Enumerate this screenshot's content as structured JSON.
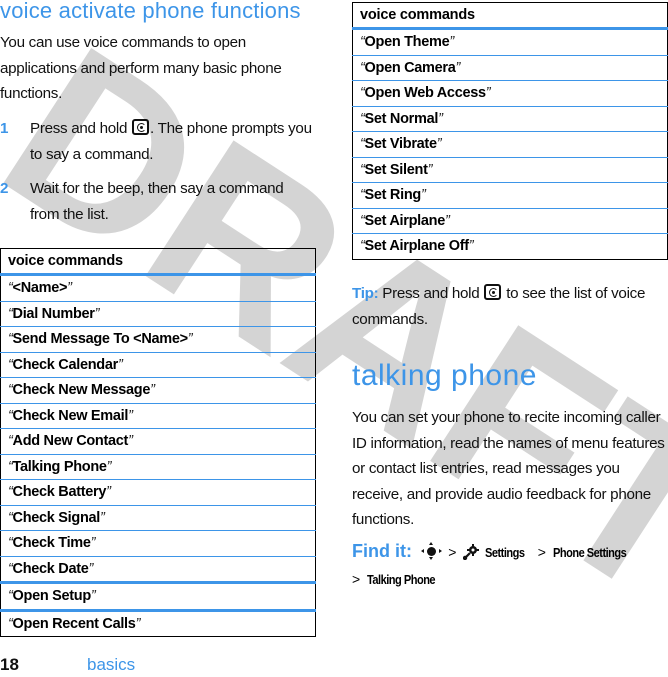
{
  "watermark": "DRAFT",
  "colors": {
    "accent": "#3d95e8",
    "text": "#111111",
    "watermark": "#d4d4d4"
  },
  "left": {
    "heading": "voice activate phone functions",
    "intro": "You can use voice commands to open applications and perform many basic phone functions.",
    "steps": [
      {
        "num": "1",
        "before_icon": "Press and hold ",
        "icon": "voice-key-icon",
        "after_icon": ". The phone prompts you to say a command."
      },
      {
        "num": "2",
        "text": "Wait for the beep, then say a command from the list."
      }
    ],
    "table": {
      "header": "voice commands",
      "rows": [
        "<Name>",
        "Dial Number",
        "Send Message To <Name>",
        "Check Calendar",
        "Check New Message",
        "Check New Email",
        "Add New Contact",
        "Talking Phone",
        "Check Battery",
        "Check Signal",
        "Check Time",
        "Check Date",
        "Open Setup",
        "Open Recent Calls"
      ]
    }
  },
  "right": {
    "table": {
      "header": "voice commands",
      "rows": [
        "Open Theme",
        "Open Camera",
        "Open Web Access",
        "Set Normal",
        "Set Vibrate",
        "Set Silent",
        "Set Ring",
        "Set Airplane",
        "Set Airplane Off"
      ]
    },
    "tip": {
      "label": "Tip:",
      "before_icon": " Press and hold ",
      "icon": "voice-key-icon",
      "after_icon": " to see the list of voice commands."
    },
    "heading": "talking phone",
    "body": "You can set your phone to recite incoming caller ID information, read the names of menu features or contact list entries, read messages you receive, and provide audio feedback for phone functions.",
    "find_it": {
      "label": "Find it:",
      "icons": [
        "nav-key-icon",
        "settings-icon"
      ],
      "separator": ">",
      "path": [
        "Settings",
        "Phone Settings",
        "Talking Phone"
      ]
    }
  },
  "footer": {
    "page_number": "18",
    "section": "basics"
  },
  "quote_open": "“",
  "quote_close": "”"
}
